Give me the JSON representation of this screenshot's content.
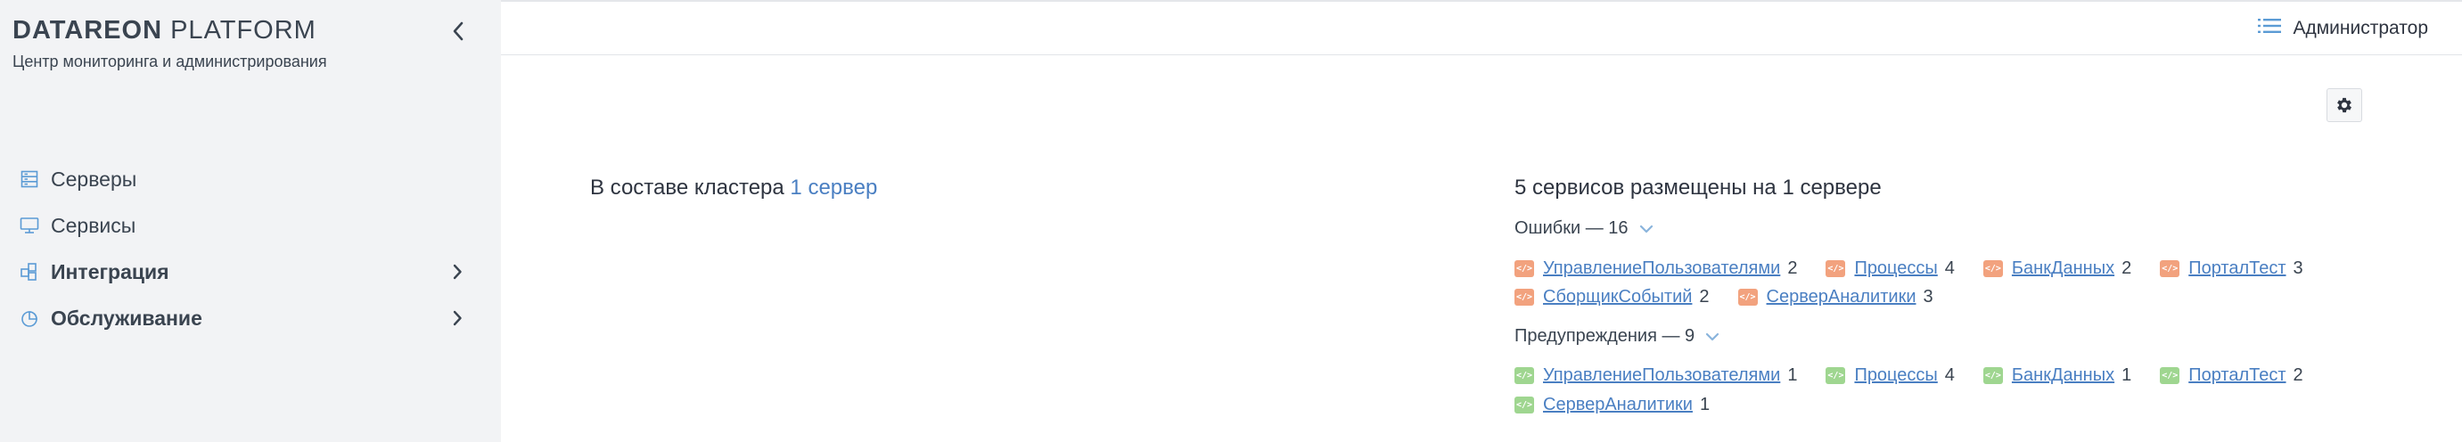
{
  "sidebar": {
    "brand_bold": "DATAREON",
    "brand_light": "PLATFORM",
    "subtitle": "Центр мониторинга и администрирования",
    "items": [
      {
        "label": "Серверы",
        "icon": "servers-icon"
      },
      {
        "label": "Сервисы",
        "icon": "monitor-icon"
      },
      {
        "label": "Интеграция",
        "icon": "integration-icon",
        "expandable": true
      },
      {
        "label": "Обслуживание",
        "icon": "pie-chart-icon",
        "expandable": true
      }
    ]
  },
  "header": {
    "user_label": "Администратор",
    "user_icon": "list-icon"
  },
  "cluster": {
    "prefix": "В составе кластера",
    "link": "1 сервер"
  },
  "services": {
    "title": "5 сервисов размещены на 1 сервере",
    "errors": {
      "heading": "Ошибки — 16",
      "color": "#f2a27e",
      "rows": [
        [
          {
            "name": "УправлениеПользователями",
            "count": "2"
          },
          {
            "name": "Процессы",
            "count": "4"
          },
          {
            "name": "БанкДанных",
            "count": "2"
          },
          {
            "name": "ПорталТест",
            "count": "3"
          }
        ],
        [
          {
            "name": "СборщикСобытий",
            "count": "2"
          },
          {
            "name": "СерверАналитики",
            "count": "3"
          }
        ]
      ]
    },
    "warnings": {
      "heading": "Предупреждения — 9",
      "color": "#9fd690",
      "rows": [
        [
          {
            "name": "УправлениеПользователями",
            "count": "1"
          },
          {
            "name": "Процессы",
            "count": "4"
          },
          {
            "name": "БанкДанных",
            "count": "1"
          },
          {
            "name": "ПорталТест",
            "count": "2"
          }
        ],
        [
          {
            "name": "СерверАналитики",
            "count": "1"
          }
        ]
      ]
    }
  },
  "colors": {
    "accent": "#4a7fc2",
    "icon_blue": "#5b9bd5",
    "sidebar_bg": "#f2f3f5"
  }
}
